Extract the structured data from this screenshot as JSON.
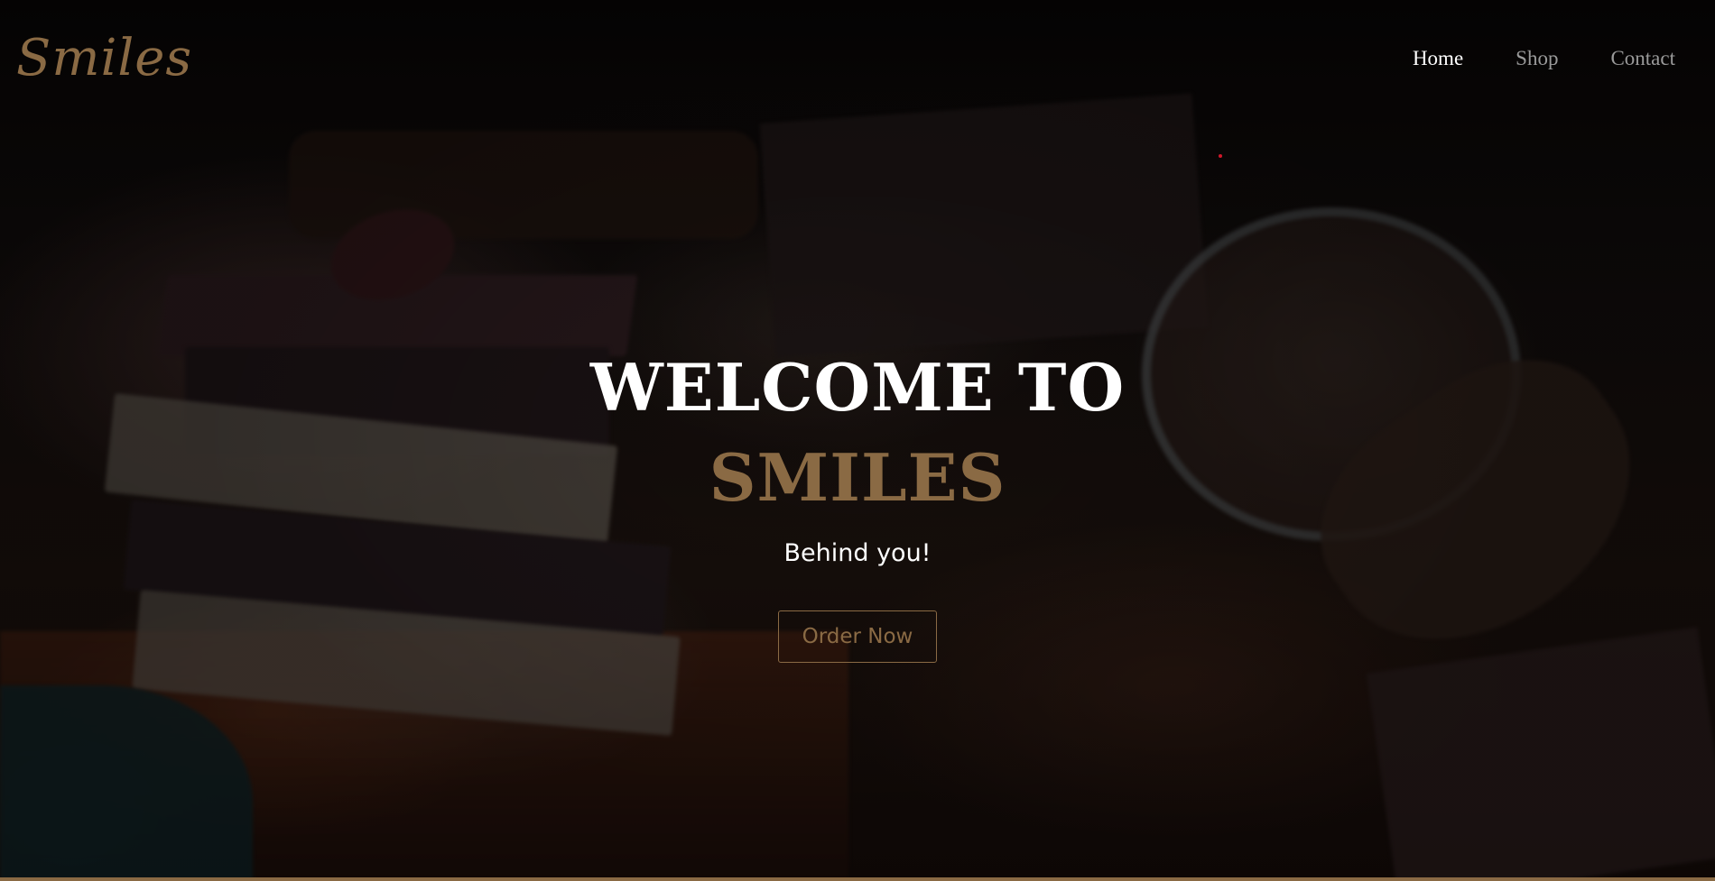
{
  "header": {
    "logo": "Smiles",
    "nav": [
      {
        "label": "Home",
        "active": true
      },
      {
        "label": "Shop",
        "active": false
      },
      {
        "label": "Contact",
        "active": false
      }
    ]
  },
  "hero": {
    "title_line1": "WELCOME TO",
    "title_line2": "SMILES",
    "subtitle": "Behind you!",
    "cta_label": "Order Now"
  },
  "colors": {
    "accent": "#8a6a44",
    "text": "#ffffff",
    "nav_inactive": "#9a9a9a",
    "background": "#0b0807"
  }
}
